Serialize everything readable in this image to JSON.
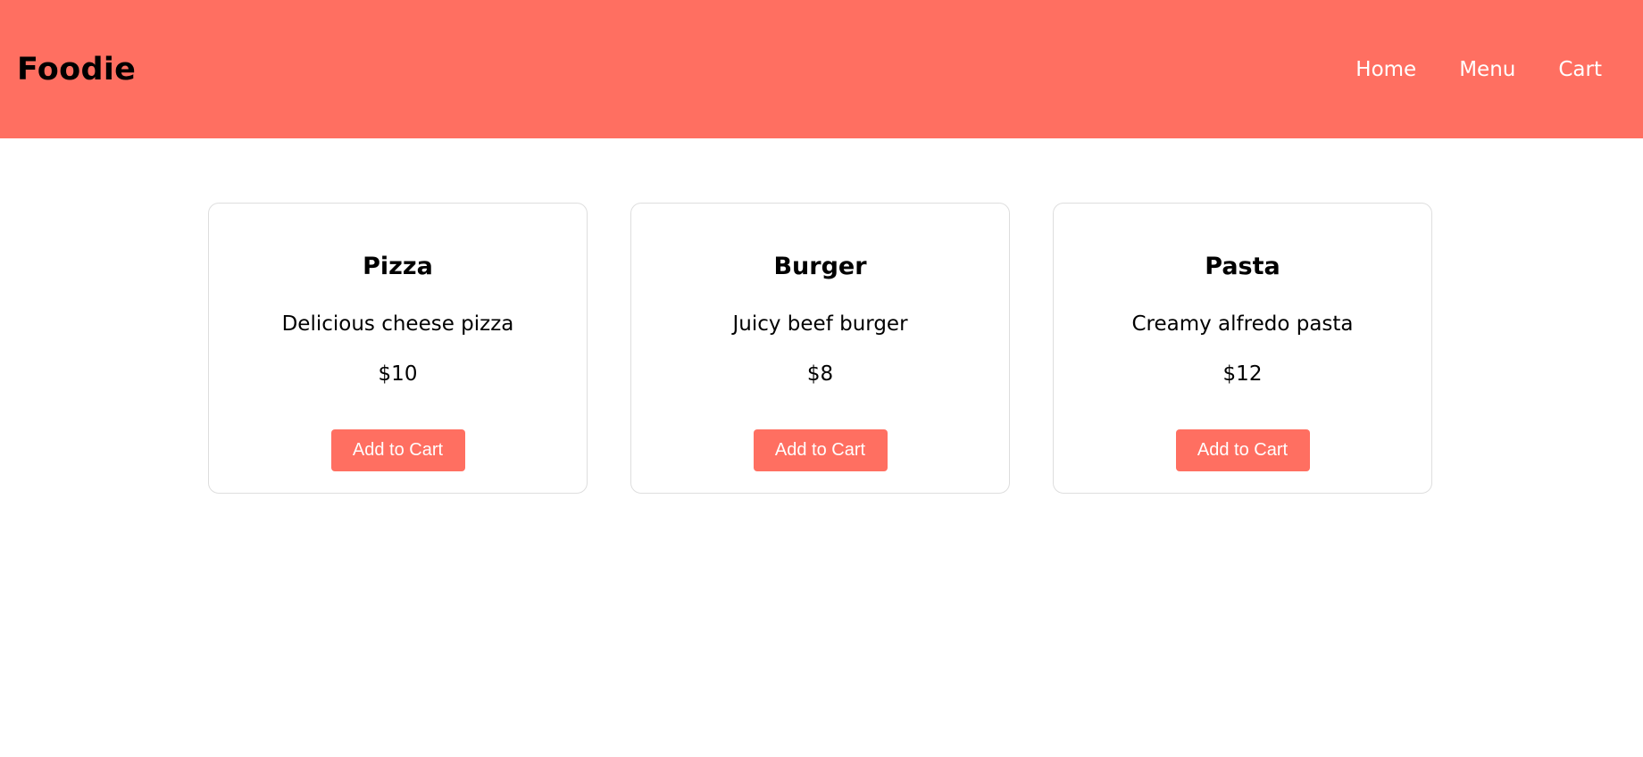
{
  "header": {
    "brand": "Foodie",
    "nav": [
      {
        "label": "Home"
      },
      {
        "label": "Menu"
      },
      {
        "label": "Cart"
      }
    ],
    "background_color": "#ff6f61"
  },
  "menu": {
    "items": [
      {
        "name": "Pizza",
        "description": "Delicious cheese pizza",
        "price": "$10",
        "button_label": "Add to Cart"
      },
      {
        "name": "Burger",
        "description": "Juicy beef burger",
        "price": "$8",
        "button_label": "Add to Cart"
      },
      {
        "name": "Pasta",
        "description": "Creamy alfredo pasta",
        "price": "$12",
        "button_label": "Add to Cart"
      }
    ]
  },
  "colors": {
    "accent": "#ff6f61",
    "card_border": "#dedede"
  }
}
